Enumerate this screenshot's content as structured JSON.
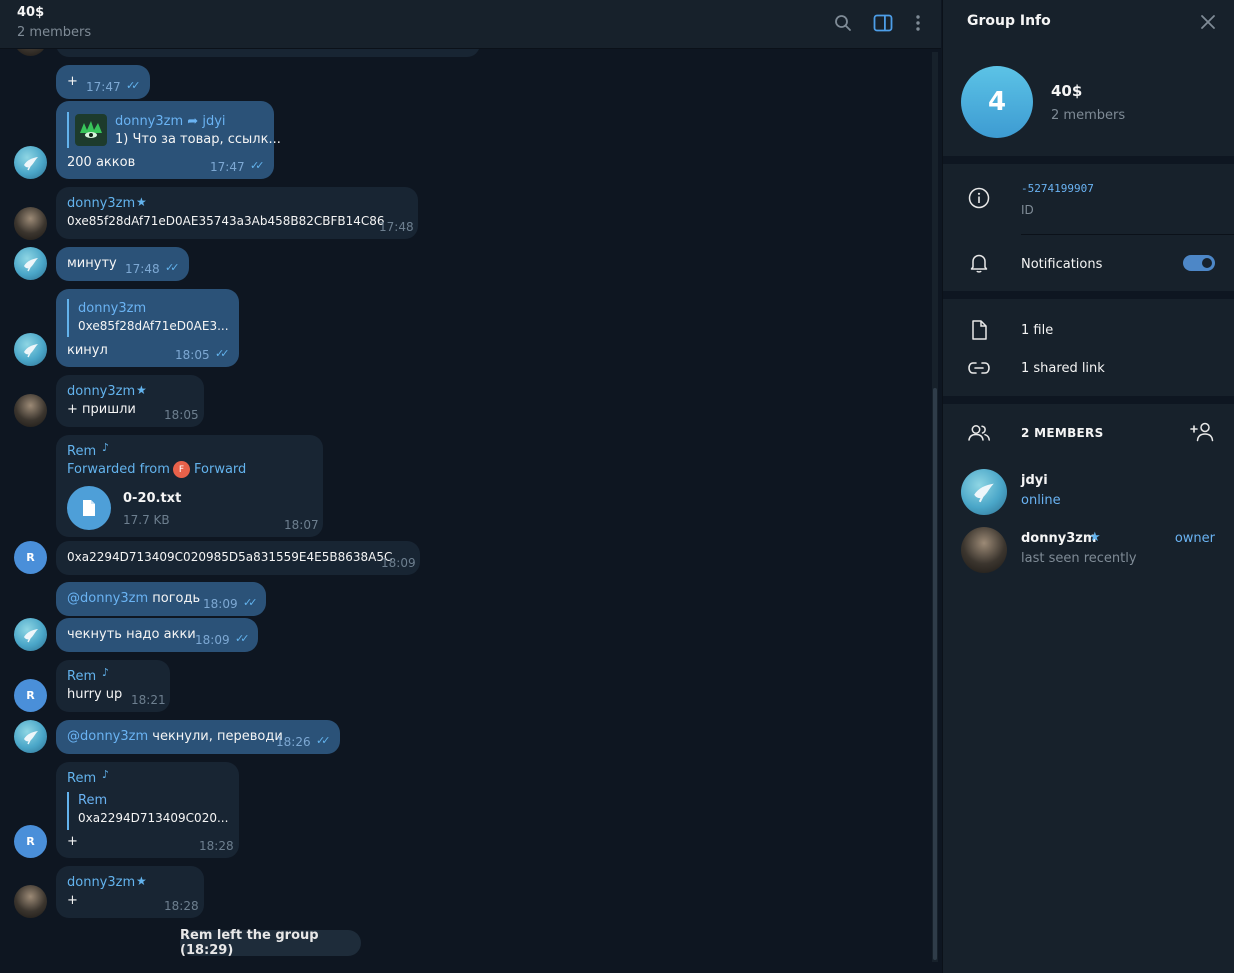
{
  "chat": {
    "title": "40$",
    "subtitle": "2 members"
  },
  "messages": [
    {
      "text": "+",
      "time": "17:47"
    },
    {
      "reply_name": "donny3zm",
      "forward_arrow": "➦",
      "reply_to": "jdyi",
      "reply_text": "1) Что за товар, ссылк...",
      "text": "200 акков",
      "time": "17:47"
    },
    {
      "name": "donny3zm",
      "text": "0xe85f28dAf71eD0AE35743a3Ab458B82CBFB14C86",
      "time": "17:48"
    },
    {
      "text": "минуту",
      "time": "17:48"
    },
    {
      "reply_name": "donny3zm",
      "reply_text": "0xe85f28dAf71eD0AE3...",
      "text": "кинул",
      "time": "18:05"
    },
    {
      "name": "donny3zm",
      "text": "+ пришли",
      "time": "18:05"
    },
    {
      "name": "Rem",
      "forwarded_label": "Forwarded from",
      "forwarded_badge": "F",
      "forwarded_from": "Forward",
      "file_name": "0-20.txt",
      "file_size": "17.7 KB",
      "time": "18:07"
    },
    {
      "text": "0xa2294D713409C020985D5a831559E4E5B8638A5C",
      "time": "18:09"
    },
    {
      "mention": "@donny3zm",
      "text": " погодь",
      "time": "18:09"
    },
    {
      "text": "чекнуть надо акки",
      "time": "18:09"
    },
    {
      "name": "Rem",
      "text": "hurry up",
      "time": "18:21"
    },
    {
      "mention": "@donny3zm",
      "text": " чекнули, переводи",
      "time": "18:26"
    },
    {
      "name": "Rem",
      "reply_name": "Rem",
      "reply_text": "0xa2294D713409C020...",
      "text": "+",
      "time": "18:28"
    },
    {
      "name": "donny3zm",
      "text": "+",
      "time": "18:28"
    }
  ],
  "avatar_letter": "R",
  "service_message": "Rem left the group (18:29)",
  "info": {
    "title": "Group Info",
    "avatar_letter": "4",
    "group_name": "40$",
    "members_count": "2 members",
    "id_value": "-5274199907",
    "id_label": "ID",
    "notifications_label": "Notifications",
    "notifications_on": true,
    "files_label": "1 file",
    "links_label": "1 shared link",
    "members_header": "2 MEMBERS",
    "members": [
      {
        "name": "jdyi",
        "status": "online",
        "role": ""
      },
      {
        "name": "donny3zm",
        "status": "last seen recently",
        "role": "owner"
      }
    ]
  },
  "colors": {
    "background": "#0e1621",
    "panel": "#17212b",
    "incoming_bubble": "#182533",
    "outgoing_bubble": "#2b5278",
    "accent": "#63b3ed"
  }
}
